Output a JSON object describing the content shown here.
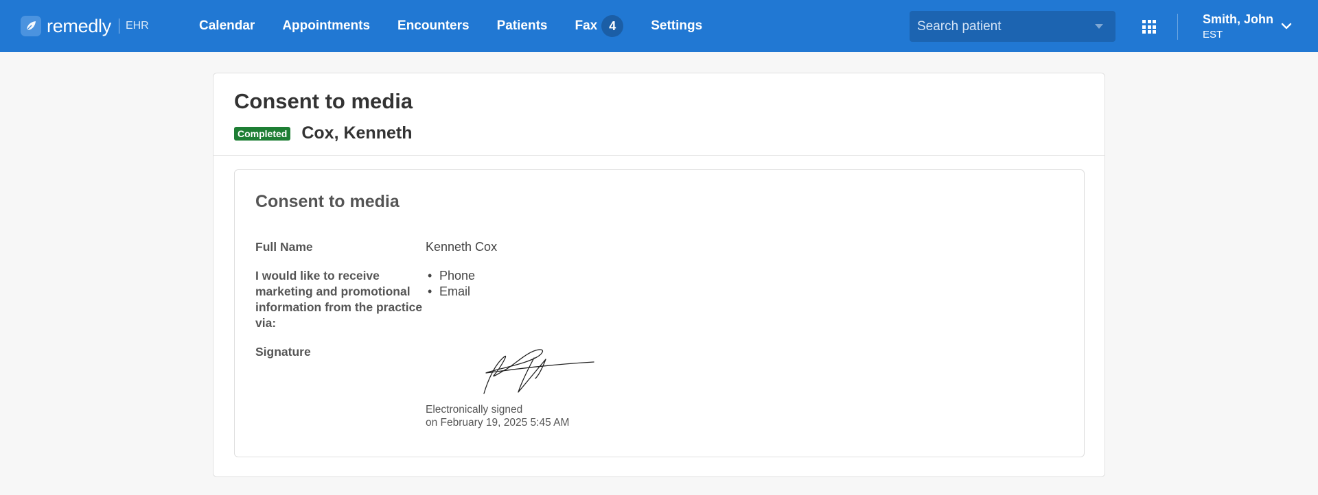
{
  "app": {
    "name": "remedly",
    "suffix": "EHR"
  },
  "nav": [
    {
      "label": "Calendar"
    },
    {
      "label": "Appointments"
    },
    {
      "label": "Encounters"
    },
    {
      "label": "Patients"
    },
    {
      "label": "Fax",
      "badge": "4"
    },
    {
      "label": "Settings"
    }
  ],
  "search": {
    "placeholder": "Search patient"
  },
  "user": {
    "name": "Smith, John",
    "timezone": "EST"
  },
  "page": {
    "title": "Consent to media",
    "status": "Completed",
    "patient": "Cox, Kenneth"
  },
  "form": {
    "title": "Consent to media",
    "full_name_label": "Full Name",
    "full_name_value": "Kenneth Cox",
    "marketing_label": "I would like to receive marketing and promotional information from the practice via:",
    "marketing_options": [
      "Phone",
      "Email"
    ],
    "signature_label": "Signature",
    "signed_line1": "Electronically signed",
    "signed_line2": "on February 19, 2025 5:45 AM"
  },
  "colors": {
    "header": "#2178d3",
    "status": "#1e7e34"
  },
  "icons": {
    "logo": "leaf-icon",
    "apps": "grid-icon",
    "user_menu": "chevron-down-icon",
    "search_dropdown": "caret-down-icon"
  }
}
